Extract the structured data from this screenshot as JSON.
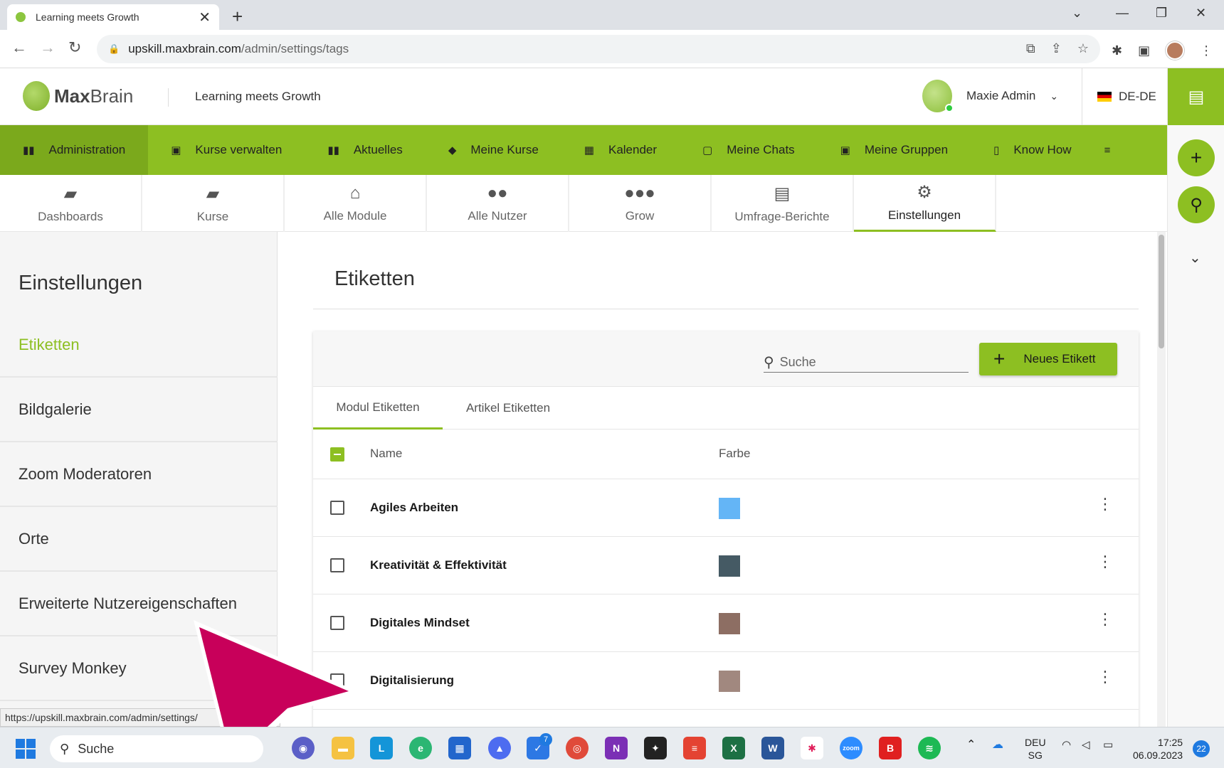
{
  "browser": {
    "tab_title": "Learning meets Growth",
    "url_host": "upskill.maxbrain.com",
    "url_path": "/admin/settings/tags"
  },
  "header": {
    "logo_bold": "Max",
    "logo_light": "Brain",
    "slogan": "Learning meets Growth",
    "user_name": "Maxie Admin",
    "language": "DE-DE"
  },
  "main_nav": [
    {
      "label": "Administration",
      "icon": "admin-icon"
    },
    {
      "label": "Kurse verwalten",
      "icon": "course-manage-icon"
    },
    {
      "label": "Aktuelles",
      "icon": "news-icon"
    },
    {
      "label": "Meine Kurse",
      "icon": "graduation-cap-icon"
    },
    {
      "label": "Kalender",
      "icon": "calendar-icon"
    },
    {
      "label": "Meine Chats",
      "icon": "chat-icon"
    },
    {
      "label": "Meine Gruppen",
      "icon": "groups-icon"
    },
    {
      "label": "Know How",
      "icon": "book-icon"
    }
  ],
  "sub_tabs": [
    {
      "label": "Dashboards",
      "icon": "dashboard-icon"
    },
    {
      "label": "Kurse",
      "icon": "course-icon"
    },
    {
      "label": "Alle Module",
      "icon": "institution-icon"
    },
    {
      "label": "Alle Nutzer",
      "icon": "users-icon"
    },
    {
      "label": "Grow",
      "icon": "people-group-icon"
    },
    {
      "label": "Umfrage-Berichte",
      "icon": "report-icon"
    },
    {
      "label": "Einstellungen",
      "icon": "gears-icon"
    }
  ],
  "sidebar": {
    "title": "Einstellungen",
    "items": [
      "Etiketten",
      "Bildgalerie",
      "Zoom Moderatoren",
      "Orte",
      "Erweiterte Nutzereigenschaften",
      "Survey Monkey"
    ]
  },
  "page": {
    "title": "Etiketten",
    "search_placeholder": "Suche",
    "new_button": "Neues Etikett",
    "tabs": [
      "Modul Etiketten",
      "Artikel Etiketten"
    ],
    "col_name": "Name",
    "col_color": "Farbe",
    "rows": [
      {
        "name": "Agiles Arbeiten",
        "color": "#64b5f6"
      },
      {
        "name": "Kreativität & Effektivität",
        "color": "#455a64"
      },
      {
        "name": "Digitales Mindset",
        "color": "#8d6e63"
      },
      {
        "name": "Digitalisierung",
        "color": "#a1887f"
      }
    ]
  },
  "status_url": "https://upskill.maxbrain.com/admin/settings/",
  "taskbar": {
    "search": "Suche",
    "lang_top": "DEU",
    "lang_bottom": "SG",
    "time": "17:25",
    "date": "06.09.2023",
    "notif_count": "22",
    "todo_badge": "7"
  },
  "colors": {
    "brand_green": "#8dbf22",
    "annotation_arrow": "#c8005a"
  }
}
